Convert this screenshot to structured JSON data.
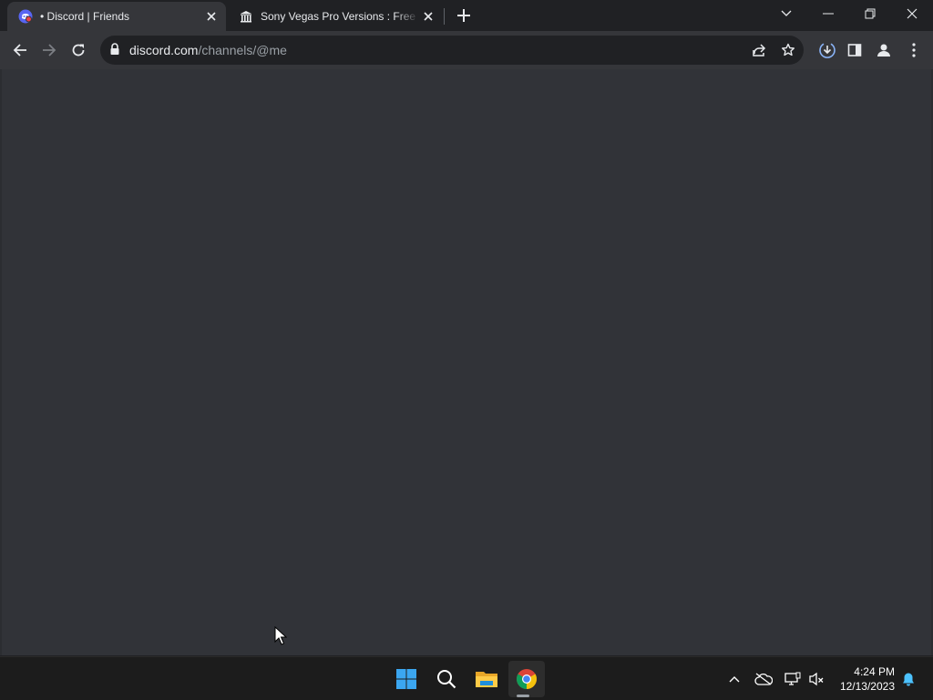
{
  "tabs": [
    {
      "title": "• Discord | Friends",
      "icon": "discord-icon",
      "active": true
    },
    {
      "title": "Sony Vegas Pro Versions : Free Download, Borrow",
      "icon": "archive-building-icon",
      "active": false
    }
  ],
  "address_bar": {
    "host": "discord.com",
    "path": "/channels/@me"
  },
  "icons": {
    "back": "arrow-left-icon",
    "forward": "arrow-right-icon",
    "reload": "reload-icon",
    "lock": "lock-icon",
    "share": "share-icon",
    "bookmark": "star-icon",
    "downloads": "download-icon",
    "side_panel": "side-panel-icon",
    "profile": "profile-icon",
    "menu": "kebab-menu-icon"
  },
  "colors": {
    "page_background": "#313338",
    "browser_frame": "#202124",
    "toolbar": "#35363a",
    "notification_blue": "#4cc2ff"
  },
  "taskbar": {
    "apps": [
      "windows-start-icon",
      "search-icon",
      "file-explorer-icon",
      "chrome-icon"
    ],
    "active_app": "chrome-icon",
    "tray_icons": [
      "chevron-up-icon",
      "onedrive-icon",
      "network-icon",
      "volume-muted-icon",
      "notification-bell-icon"
    ]
  },
  "clock": {
    "time": "4:24 PM",
    "date": "12/13/2023"
  }
}
